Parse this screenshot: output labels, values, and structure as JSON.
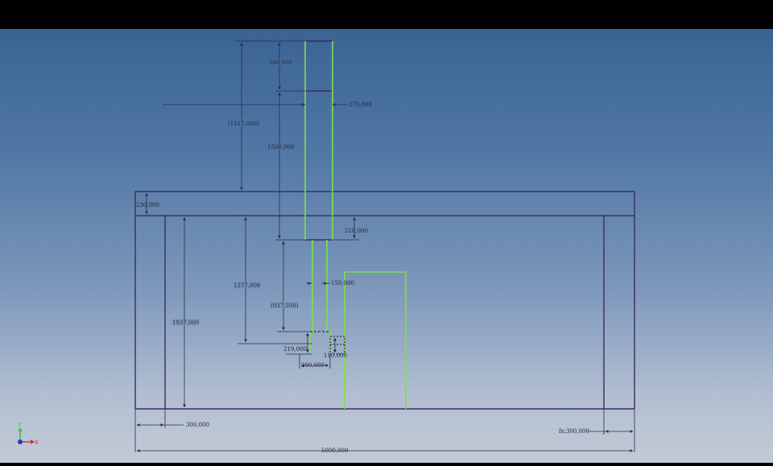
{
  "dimensions": {
    "d500": "500,000",
    "d270": "270,000",
    "d1517": "(1517,000)",
    "d1500": "1500,000",
    "d230": "230,000",
    "d210": "210,000",
    "d1277": "1277,000",
    "d150": "150,000",
    "d1937": "1937,000",
    "d937": "(937,500)",
    "d219": "219,000",
    "d110": "110,000",
    "d200": "200,000",
    "d300": "300,000",
    "dfx300": "fx:300,000",
    "d5000": "5000,000"
  },
  "axis_triad": {
    "y_label": "Y",
    "x_label": "X"
  },
  "colors": {
    "outline": "#3c2a68",
    "green": "#7fe04a",
    "dimension": "#2b2d44"
  }
}
